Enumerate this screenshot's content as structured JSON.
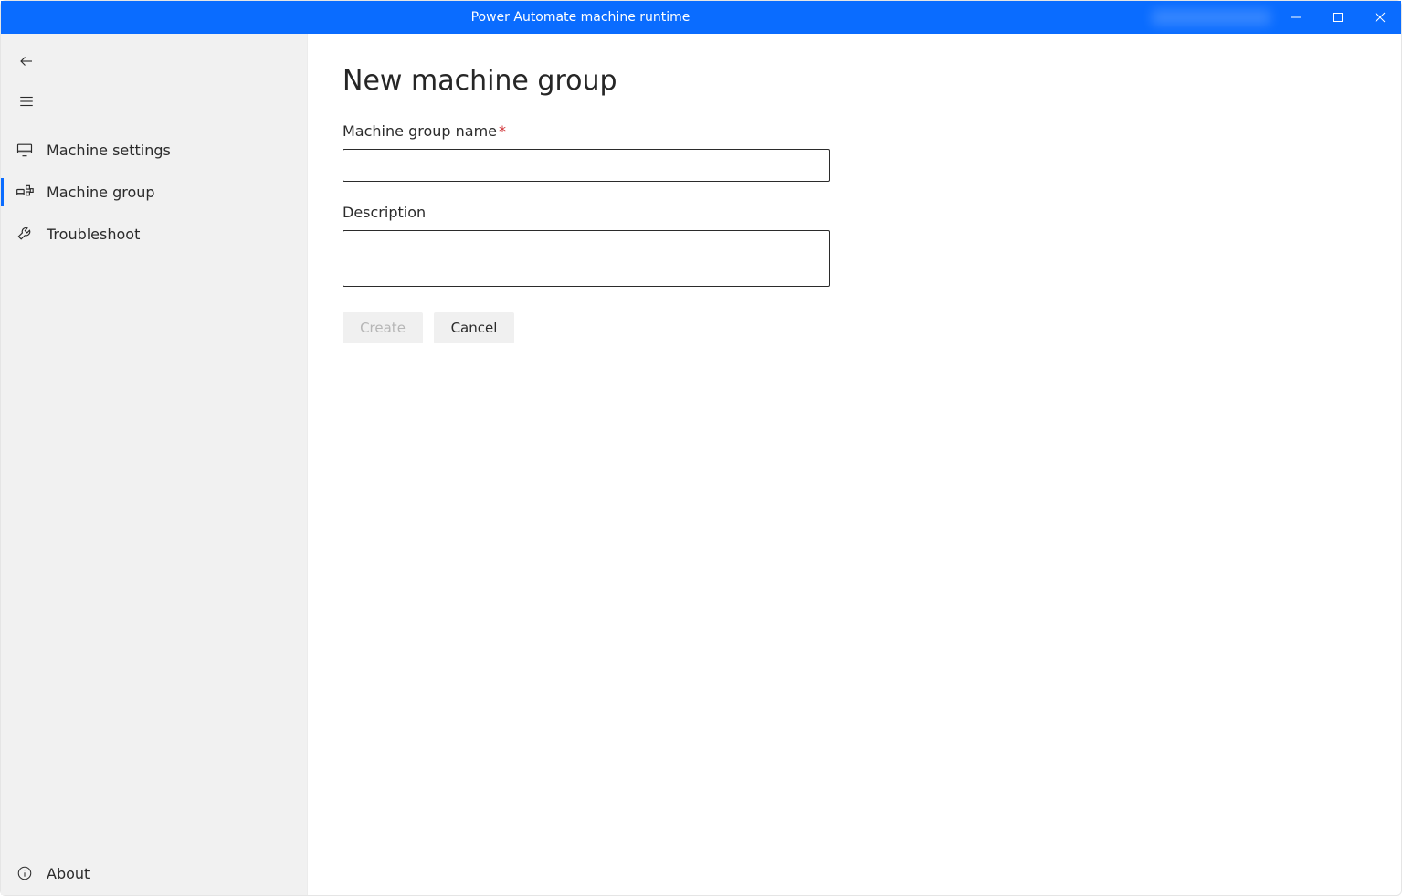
{
  "titlebar": {
    "title": "Power Automate machine runtime"
  },
  "sidebar": {
    "items": [
      {
        "label": "Machine settings"
      },
      {
        "label": "Machine group"
      },
      {
        "label": "Troubleshoot"
      }
    ],
    "about_label": "About"
  },
  "main": {
    "page_title": "New machine group",
    "name_label": "Machine group name",
    "name_value": "",
    "desc_label": "Description",
    "desc_value": "",
    "create_label": "Create",
    "cancel_label": "Cancel"
  }
}
